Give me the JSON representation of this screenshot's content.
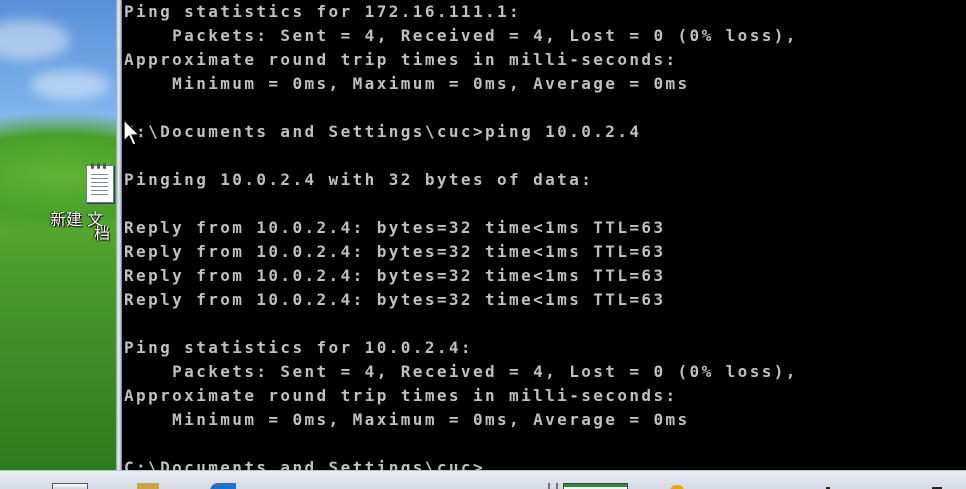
{
  "desktop": {
    "icon_label_line1": "新建 文",
    "icon_label_line2": "档",
    "icon_name": "notepad-text-document-icon"
  },
  "console": {
    "lines": [
      "Ping statistics for 172.16.111.1:",
      "    Packets: Sent = 4, Received = 4, Lost = 0 (0% loss),",
      "Approximate round trip times in milli-seconds:",
      "    Minimum = 0ms, Maximum = 0ms, Average = 0ms",
      "",
      "C:\\Documents and Settings\\cuc>ping 10.0.2.4",
      "",
      "Pinging 10.0.2.4 with 32 bytes of data:",
      "",
      "Reply from 10.0.2.4: bytes=32 time<1ms TTL=63",
      "Reply from 10.0.2.4: bytes=32 time<1ms TTL=63",
      "Reply from 10.0.2.4: bytes=32 time<1ms TTL=63",
      "Reply from 10.0.2.4: bytes=32 time<1ms TTL=63",
      "",
      "Ping statistics for 10.0.2.4:",
      "    Packets: Sent = 4, Received = 4, Lost = 0 (0% loss),",
      "Approximate round trip times in milli-seconds:",
      "    Minimum = 0ms, Maximum = 0ms, Average = 0ms",
      "",
      "C:\\Documents and Settings\\cuc>"
    ]
  },
  "colors": {
    "console_bg": "#000000",
    "console_text": "#c0c0c0"
  }
}
